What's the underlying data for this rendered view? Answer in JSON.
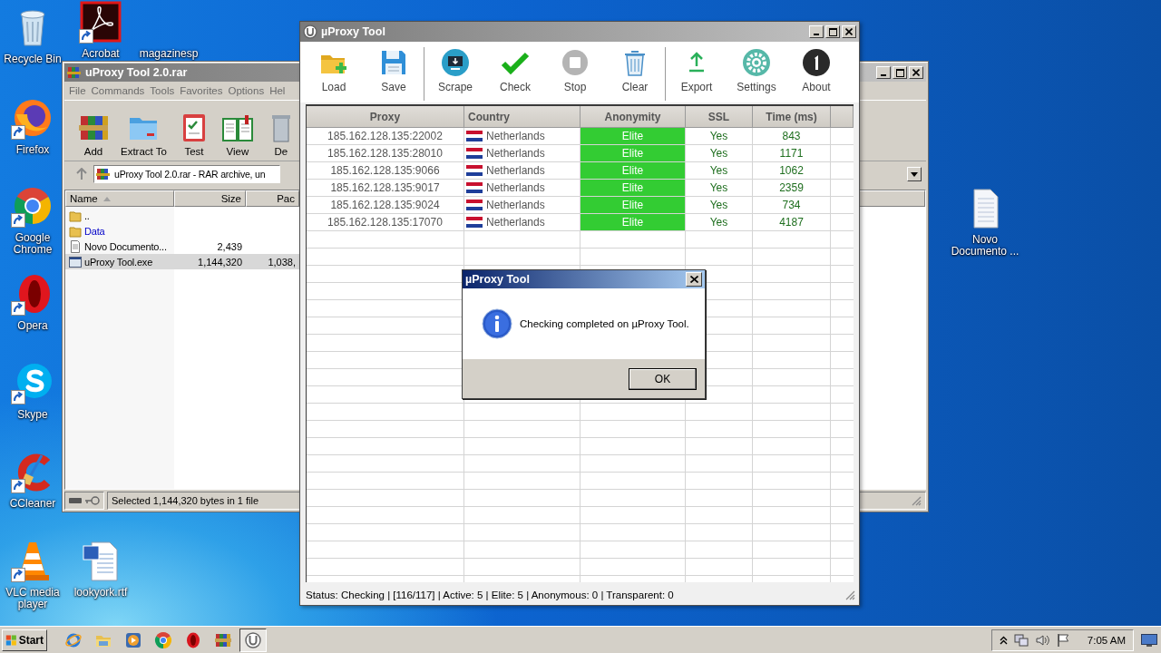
{
  "desktop": {
    "icons": [
      {
        "label": "Recycle Bin",
        "kind": "recycle",
        "shortcut": false
      },
      {
        "label": "Acrobat",
        "kind": "acrobat",
        "shortcut": true
      },
      {
        "label": "magazinesp",
        "kind": "blank",
        "shortcut": false
      },
      {
        "label": "Firefox",
        "kind": "firefox",
        "shortcut": true
      },
      {
        "label": "Google Chrome",
        "kind": "chrome",
        "shortcut": true
      },
      {
        "label": "Opera",
        "kind": "opera",
        "shortcut": true
      },
      {
        "label": "Skype",
        "kind": "skype",
        "shortcut": true
      },
      {
        "label": "CCleaner",
        "kind": "ccleaner",
        "shortcut": true
      },
      {
        "label": "VLC media player",
        "kind": "vlc",
        "shortcut": true
      },
      {
        "label": "lookyork.rtf",
        "kind": "word",
        "shortcut": false
      },
      {
        "label": "Novo Documento ...",
        "kind": "text",
        "shortcut": false
      }
    ]
  },
  "winrar": {
    "title": "uProxy Tool 2.0.rar",
    "active": false,
    "menu": [
      "File",
      "Commands",
      "Tools",
      "Favorites",
      "Options",
      "Hel"
    ],
    "toolbar": [
      {
        "label": "Add",
        "kind": "add"
      },
      {
        "label": "Extract To",
        "kind": "extract"
      },
      {
        "label": "Test",
        "kind": "test"
      },
      {
        "label": "View",
        "kind": "view"
      },
      {
        "label": "De",
        "kind": "delete"
      }
    ],
    "address": "uProxy Tool 2.0.rar - RAR archive, un",
    "columns": [
      {
        "label": "Name",
        "sorted": true
      },
      {
        "label": "Size",
        "sorted": false
      },
      {
        "label": "Pac",
        "sorted": false
      }
    ],
    "files": [
      {
        "name": "..",
        "kind": "folder",
        "selected": false
      },
      {
        "name": "Data",
        "kind": "folder",
        "color": "#0000c8",
        "selected": false
      },
      {
        "name": "Novo Documento...",
        "kind": "text",
        "color": "#000000",
        "size": "2,439",
        "selected": false
      },
      {
        "name": "uProxy Tool.exe",
        "kind": "exe",
        "color": "#000000",
        "size": "1,144,320",
        "packed": "1,038,",
        "selected": true
      }
    ],
    "status": "Selected 1,144,320 bytes in 1 file"
  },
  "uproxy": {
    "title": "µProxy Tool",
    "active": false,
    "toolbar": [
      {
        "buttons": [
          {
            "label": "Load",
            "kind": "load"
          },
          {
            "label": "Save",
            "kind": "save"
          }
        ]
      },
      {
        "buttons": [
          {
            "label": "Scrape",
            "kind": "scrape"
          },
          {
            "label": "Check",
            "kind": "check"
          },
          {
            "label": "Stop",
            "kind": "stop"
          },
          {
            "label": "Clear",
            "kind": "clear"
          }
        ]
      },
      {
        "buttons": [
          {
            "label": "Export",
            "kind": "export"
          },
          {
            "label": "Settings",
            "kind": "settings"
          },
          {
            "label": "About",
            "kind": "about"
          }
        ]
      }
    ],
    "columns": [
      "Proxy",
      "Country",
      "Anonymity",
      "SSL",
      "Time (ms)"
    ],
    "rows": [
      {
        "proxy": "185.162.128.135:22002",
        "country": "Netherlands",
        "anonymity": "Elite",
        "color": "#33cc33",
        "ssl": "Yes",
        "time": "843"
      },
      {
        "proxy": "185.162.128.135:28010",
        "country": "Netherlands",
        "anonymity": "Elite",
        "color": "#33cc33",
        "ssl": "Yes",
        "time": "1171"
      },
      {
        "proxy": "185.162.128.135:9066",
        "country": "Netherlands",
        "anonymity": "Elite",
        "color": "#33cc33",
        "ssl": "Yes",
        "time": "1062"
      },
      {
        "proxy": "185.162.128.135:9017",
        "country": "Netherlands",
        "anonymity": "Elite",
        "color": "#33cc33",
        "ssl": "Yes",
        "time": "2359"
      },
      {
        "proxy": "185.162.128.135:9024",
        "country": "Netherlands",
        "anonymity": "Elite",
        "color": "#33cc33",
        "ssl": "Yes",
        "time": "734"
      },
      {
        "proxy": "185.162.128.135:17070",
        "country": "Netherlands",
        "anonymity": "Elite",
        "color": "#33cc33",
        "ssl": "Yes",
        "time": "4187"
      }
    ],
    "status": "Status: Checking | [116/117] | Active: 5 | Elite: 5 | Anonymous: 0 | Transparent: 0"
  },
  "dialog": {
    "title": "µProxy Tool",
    "message": "Checking completed on µProxy Tool.",
    "button": "OK"
  },
  "taskbar": {
    "start": "Start",
    "apps": [
      {
        "kind": "ie",
        "active": false
      },
      {
        "kind": "explorer",
        "active": false
      },
      {
        "kind": "media",
        "active": false
      },
      {
        "kind": "chrome",
        "active": false
      },
      {
        "kind": "opera",
        "active": false
      },
      {
        "kind": "winrar",
        "active": false
      },
      {
        "kind": "uproxy",
        "active": true
      }
    ],
    "clock": "7:05 AM"
  }
}
